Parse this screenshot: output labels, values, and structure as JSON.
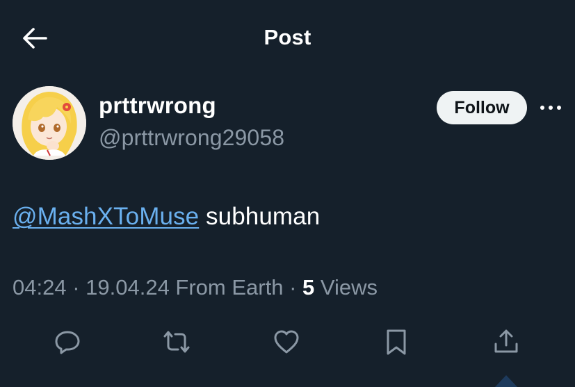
{
  "header": {
    "title": "Post",
    "back_icon": "arrow-left-icon"
  },
  "author": {
    "display_name": "prttrwrong",
    "handle": "@prttrwrong29058",
    "avatar": "anime-character-avatar",
    "follow_label": "Follow",
    "more_icon": "more-horizontal-icon"
  },
  "tweet": {
    "mention": "@MashXToMuse",
    "text": " subhuman"
  },
  "meta": {
    "time": "04:24",
    "separator": " · ",
    "date": "19.04.24",
    "location": " From Earth",
    "views_count": "5",
    "views_label": " Views"
  },
  "actions": [
    {
      "name": "reply-icon"
    },
    {
      "name": "retweet-icon"
    },
    {
      "name": "like-icon"
    },
    {
      "name": "bookmark-icon"
    },
    {
      "name": "share-icon"
    }
  ],
  "colors": {
    "background": "#15202b",
    "text_primary": "#ffffff",
    "text_secondary": "#8b98a5",
    "link": "#6ab0ef",
    "follow_bg": "#eff3f4"
  }
}
